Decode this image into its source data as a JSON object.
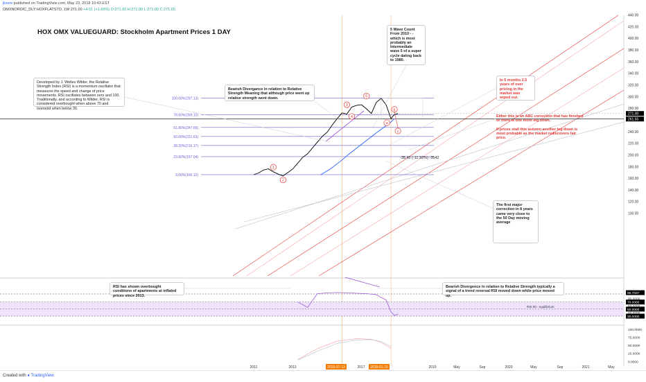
{
  "header": {
    "user": "jkssrs",
    "publish_line": "published on TradingView.com, May 23, 2018 10:43 EST",
    "symbol": "OMXNORDIC_DLY:HOXFLATSTO, 1W",
    "last": "271.00",
    "change": "+4.51 (+1.69%)",
    "ohlc": "O:271.00 H:271.00 L:271.00 C:271.00"
  },
  "title": "HOX OMX VALUEGUARD: Stockholm Apartment Prices 1 DAY",
  "notes": {
    "rsi_def": "Developed by J. Welles Wilder, the Relative Strength Index (RSI) is a momentum oscillator that measures the speed and change of price movements. RSI oscillates between zero and 100. Traditionally, and according to Wilder, RSI is considered overbought when above 70 and oversold when below 30.",
    "bearish_price": "Bearish Divergance in relation to Relative Strength Meaning that although price went up relative strength went down.",
    "wave_count": "5 Wave Count From 2010 - - which is most probably an Intermediate wave 5 of a super cycle dating back to 1980.",
    "months_red": "In 5 months 2.5 years of over pricing in the market was wiped out.",
    "abc_red": "Either this is an ABC correction that has finished or there is one more leg down.\n\nIf prices stall this autumn another leg down is most probable as the market rediscovers fair price.",
    "first_major": "The first major correction in 8 years came very close to the 50 Day moving average",
    "rsi_overbought": "RSI has shown overbought conditions of apartments at inflated prices since 2013.",
    "bearish_rsi": "Bearish Divergence in relation to Relative Strength typically a signal of a trend reversal RSI moved down while price moved up.",
    "measure": "-35.42 (-11.92%) -3542"
  },
  "fib": [
    {
      "label": "100.00%(297.13)",
      "value": 297.13
    },
    {
      "label": "78.60%(269.10)",
      "value": 269.1
    },
    {
      "label": "61.80%(247.09)",
      "value": 247.09
    },
    {
      "label": "50.00%(231.63)",
      "value": 231.63
    },
    {
      "label": "38.20%(216.17)",
      "value": 216.17
    },
    {
      "label": "23.60%(197.04)",
      "value": 197.04
    },
    {
      "label": "0.00%(166.12)",
      "value": 166.12
    }
  ],
  "waves": [
    "1",
    "2",
    "3",
    "4",
    "5",
    "a",
    "b",
    "c"
  ],
  "rsi_labels": {
    "rsi93": "RSI 93",
    "rsi50": "RSI 50 - equilibrium"
  },
  "colors": {
    "price": "#000000",
    "ma": "#2962ff",
    "channel": "#e53935",
    "fib": "#6b5fd3",
    "rsi": "#a05bd6",
    "rsi_band": "#efe3fb",
    "wave": "#e53935",
    "date_highlight": "#f57c00"
  },
  "chart_data": [
    {
      "type": "line",
      "title": "HOX OMX VALUEGUARD: Stockholm Apartment Prices 1 DAY",
      "x_axis_type": "date",
      "x_ticks": [
        "2011",
        "2013",
        "2015-07-13",
        "2017",
        "2018-01-15",
        "2019",
        "May",
        "Sep",
        "2020",
        "May",
        "Sep",
        "2021",
        "May"
      ],
      "y_ticks": [
        100,
        120,
        140,
        160,
        180,
        200,
        220,
        240,
        260,
        280,
        300,
        320,
        340,
        360,
        380,
        400,
        420,
        440
      ],
      "ylim": [
        90,
        450
      ],
      "price_labels": [
        "271.00",
        "261.55"
      ],
      "series": [
        {
          "x": [
            "2011-01",
            "2011-04",
            "2011-07",
            "2011-10",
            "2012-01",
            "2012-04",
            "2012-07",
            "2012-10",
            "2013-01",
            "2013-04",
            "2013-07",
            "2013-10",
            "2014-01",
            "2014-04",
            "2014-07",
            "2014-10",
            "2015-01",
            "2015-04",
            "2015-07",
            "2015-10",
            "2016-01",
            "2016-04",
            "2016-07",
            "2016-10",
            "2017-01",
            "2017-04",
            "2017-07",
            "2017-10",
            "2018-01",
            "2018-02",
            "2018-03",
            "2018-05"
          ],
          "values": [
            166,
            169,
            174,
            176,
            171,
            167,
            164,
            170,
            176,
            186,
            196,
            202,
            212,
            222,
            232,
            239,
            251,
            262,
            272,
            270,
            282,
            285,
            286,
            279,
            271,
            290,
            297,
            286,
            262,
            266,
            269,
            271
          ]
        },
        {
          "x": [
            "2014-06",
            "2014-12",
            "2015-06",
            "2015-12",
            "2016-06",
            "2016-12",
            "2017-06",
            "2017-12",
            "2018-03"
          ],
          "values": [
            166,
            176,
            189,
            203,
            216,
            229,
            242,
            254,
            262
          ]
        }
      ]
    },
    {
      "type": "line",
      "title": "RSI",
      "yticks": [
        30,
        40,
        50,
        60,
        70,
        80
      ],
      "ylim": [
        28,
        102
      ],
      "value_labels": [
        "96.7037",
        "70.0000",
        "50.0000",
        "30.0000"
      ],
      "levels": [
        93,
        70,
        50,
        30
      ],
      "series": [
        {
          "x": [
            "2013-04",
            "2013-10",
            "2014-04",
            "2014-10",
            "2015-04",
            "2015-10",
            "2016-04",
            "2016-10",
            "2017-04",
            "2017-07",
            "2017-10",
            "2018-01",
            "2018-03",
            "2018-05"
          ],
          "values": [
            70,
            55,
            94,
            96,
            97,
            96,
            95,
            94,
            91,
            83,
            76,
            42,
            32,
            36
          ]
        }
      ]
    },
    {
      "type": "line",
      "title": "",
      "yticks": [
        0,
        25,
        50,
        75
      ],
      "value_labels": [
        "100.0000",
        "75.0000",
        "50.0000",
        "25.0000",
        "0.0000"
      ],
      "series": [
        {
          "x": [
            "2013-04",
            "2014-04",
            "2015-04",
            "2016-04",
            "2017-01",
            "2017-07",
            "2018-01"
          ],
          "values": [
            6,
            40,
            63,
            71,
            69,
            59,
            40
          ]
        },
        {
          "x": [
            "2013-04",
            "2014-04",
            "2015-04",
            "2016-04",
            "2017-01",
            "2017-07",
            "2018-01"
          ],
          "values": [
            4,
            32,
            56,
            67,
            68,
            62,
            46
          ]
        }
      ]
    }
  ]
}
